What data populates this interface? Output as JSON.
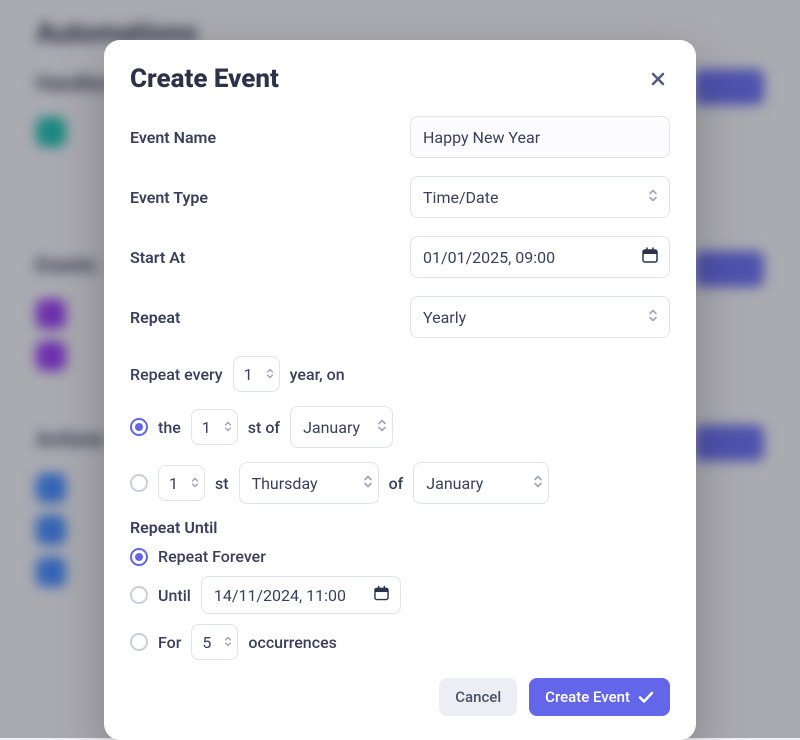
{
  "background": {
    "heading": "Automations",
    "sub1": "Handlers",
    "sub2": "Events",
    "sub3": "Actions"
  },
  "modal": {
    "title": "Create Event",
    "labels": {
      "event_name": "Event Name",
      "event_type": "Event Type",
      "start_at": "Start At",
      "repeat": "Repeat",
      "repeat_every_prefix": "Repeat every",
      "repeat_every_suffix": "year, on",
      "the": "the",
      "st_of": "st of",
      "st": "st",
      "of": "of",
      "repeat_until": "Repeat Until",
      "repeat_forever": "Repeat Forever",
      "until": "Until",
      "for_prefix": "For",
      "for_suffix": "occurrences"
    },
    "values": {
      "event_name": "Happy New Year",
      "event_type": "Time/Date",
      "start_at": "01/01/2025, 09:00",
      "repeat": "Yearly",
      "repeat_count": "1",
      "day_num": "1",
      "month1": "January",
      "ordinal": "1",
      "weekday": "Thursday",
      "month2": "January",
      "until_date": "14/11/2024, 11:00",
      "occurrences": "5"
    },
    "buttons": {
      "cancel": "Cancel",
      "create": "Create Event"
    }
  }
}
